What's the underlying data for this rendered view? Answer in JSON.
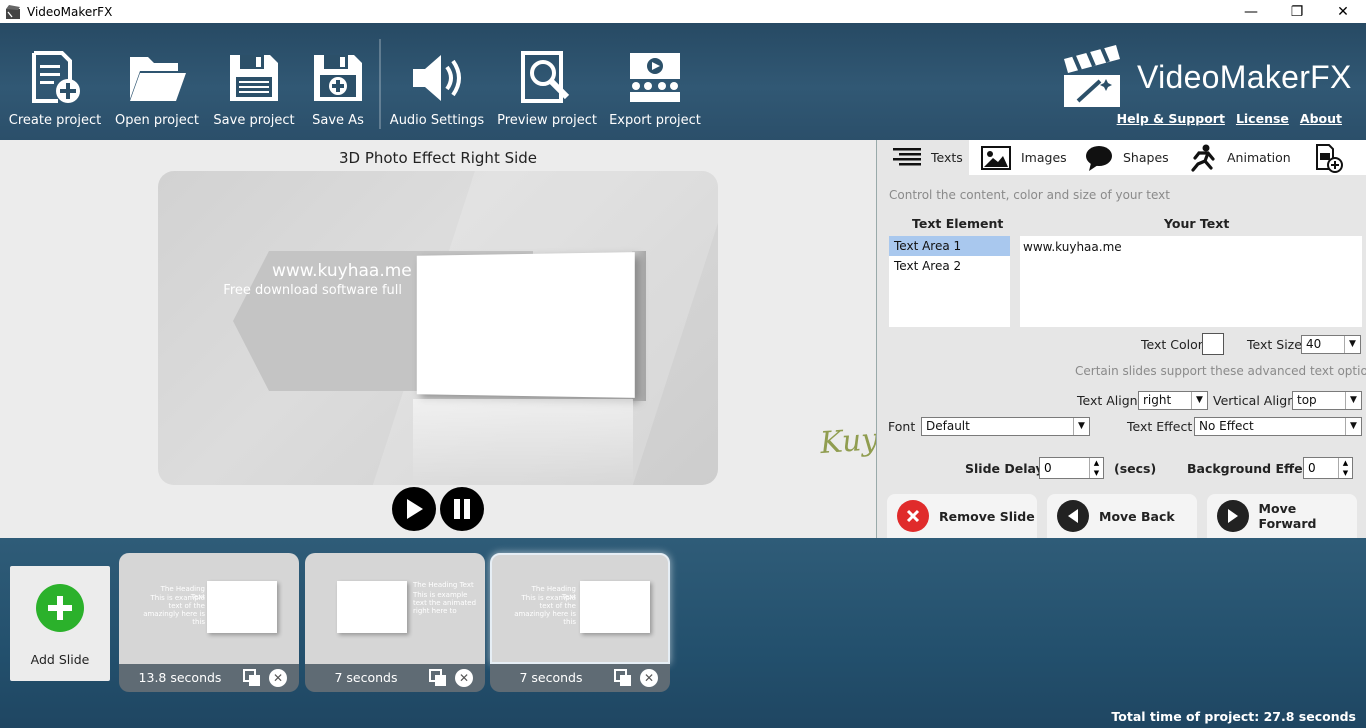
{
  "window": {
    "title": "VideoMakerFX",
    "minimize": "—",
    "maximize": "❐",
    "close": "✕"
  },
  "toolbar": {
    "create_label": "Create project",
    "open_label": "Open project",
    "save_label": "Save project",
    "saveas_label": "Save As",
    "audio_label": "Audio Settings",
    "preview_label": "Preview project",
    "export_label": "Export project"
  },
  "brand": {
    "name": "VideoMakerFX"
  },
  "links": {
    "help": "Help & Support",
    "license": "License",
    "about": "About"
  },
  "preview": {
    "title": "3D Photo Effect Right Side",
    "text_line1": "www.kuyhaa.me",
    "text_line2": "Free download software full"
  },
  "tabs": {
    "texts": "Texts",
    "images": "Images",
    "shapes": "Shapes",
    "animation": "Animation"
  },
  "texts_panel": {
    "hint": "Control the content, color and size of your text",
    "col_element": "Text Element",
    "col_text": "Your Text",
    "elements": [
      "Text Area 1",
      "Text Area 2"
    ],
    "selected_text": "www.kuyhaa.me",
    "text_color_label": "Text Color",
    "text_size_label": "Text Size",
    "text_size_value": "40",
    "advanced_hint": "Certain slides support these advanced text options.",
    "text_align_label": "Text Align",
    "text_align_value": "right",
    "vertical_align_label": "Vertical Align",
    "vertical_align_value": "top",
    "font_label": "Font",
    "font_value": "Default",
    "text_effect_label": "Text Effect",
    "text_effect_value": "No Effect",
    "slide_delay_label": "Slide Delay",
    "slide_delay_value": "0",
    "secs_label": "(secs)",
    "bg_effect_label": "Background Effect",
    "bg_effect_value": "0"
  },
  "actions": {
    "remove": "Remove Slide",
    "back": "Move Back",
    "forward": "Move Forward"
  },
  "watermark": "KuyhAa.Me",
  "timeline": {
    "add_label": "Add Slide",
    "slides": [
      {
        "duration": "13.8 seconds",
        "heading": "The Heading Text",
        "body": "This is example text of the amazingly here is this"
      },
      {
        "duration": "7 seconds",
        "heading": "The Heading Text",
        "body": "This is example text the animated right here to"
      },
      {
        "duration": "7 seconds",
        "heading": "The Heading Text",
        "body": "This is example text of the amazingly here is this"
      }
    ],
    "total": "Total time of project: 27.8 seconds"
  }
}
